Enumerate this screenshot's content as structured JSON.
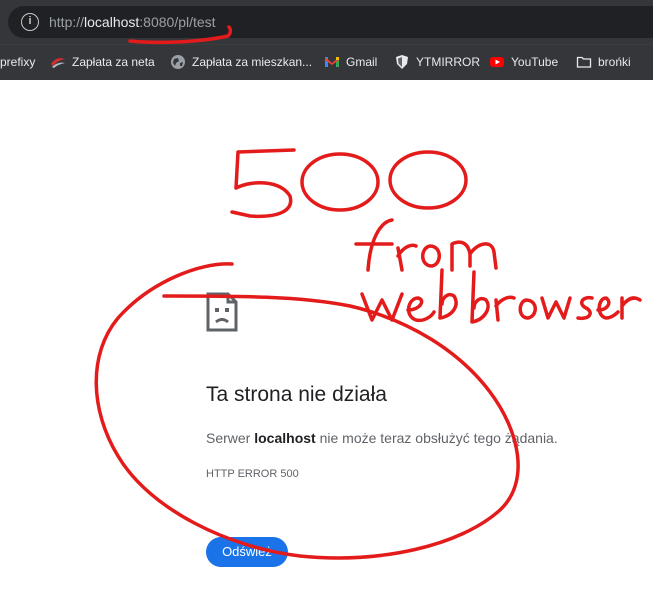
{
  "browser": {
    "url_prefix": "http://",
    "url_host": "localhost",
    "url_rest": ":8080/pl/test",
    "site_info_icon": "info-icon"
  },
  "bookmarks": [
    {
      "label": "prefixy",
      "icon": "none"
    },
    {
      "label": "Zapłata za neta",
      "icon": "bank-logo-icon"
    },
    {
      "label": "Zapłata za mieszkan...",
      "icon": "globe-icon"
    },
    {
      "label": "Gmail",
      "icon": "gmail-icon"
    },
    {
      "label": "YTMIRROR",
      "icon": "shield-icon"
    },
    {
      "label": "YouTube",
      "icon": "youtube-icon"
    },
    {
      "label": "brońki",
      "icon": "folder-icon"
    }
  ],
  "error_page": {
    "icon": "sad-page-icon",
    "title": "Ta strona nie działa",
    "desc_pre": "Serwer ",
    "desc_host": "localhost",
    "desc_post": " nie może teraz obsłużyć tego żądania.",
    "error_code": "HTTP ERROR 500",
    "reload_label": "Odśwież"
  },
  "colors": {
    "chrome_dark": "#202124",
    "toolbar": "#35363a",
    "button_blue": "#1a73e8",
    "annotation_red": "#e41b1b"
  },
  "handwritten_annotation": {
    "line1": "500",
    "line2": "from",
    "line3": "web browser"
  }
}
